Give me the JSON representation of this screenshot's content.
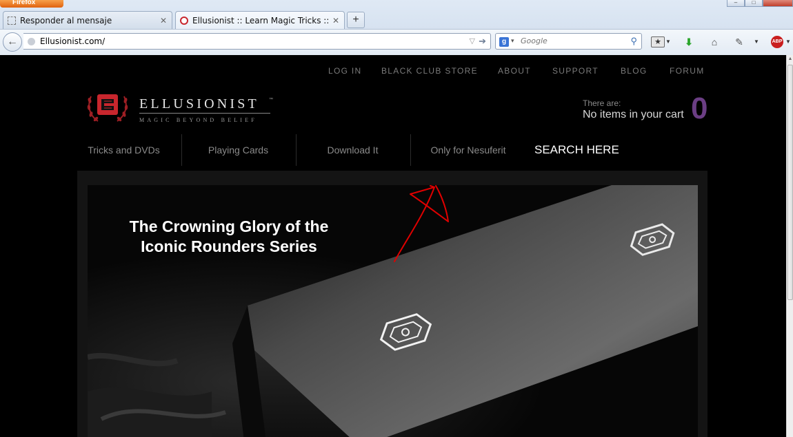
{
  "browser": {
    "app_button": "Firefox",
    "tabs": [
      {
        "label": "Responder al mensaje",
        "active": false
      },
      {
        "label": "Ellusionist :: Learn Magic Tricks :: Onli...",
        "active": true
      }
    ],
    "new_tab": "+",
    "url": "Ellusionist.com/",
    "search_engine": "Google",
    "search_placeholder": "Google"
  },
  "site": {
    "top_links": [
      "LOG IN",
      "BLACK CLUB STORE",
      "ABOUT",
      "SUPPORT",
      "BLOG",
      "FORUM"
    ],
    "logo": {
      "name": "ELLUSIONIST",
      "tm": "™",
      "tagline": "MAGIC BEYOND BELIEF"
    },
    "cart": {
      "prefix": "There are:",
      "status": "No items in your cart",
      "count": "0"
    },
    "main_nav": [
      "Tricks and DVDs",
      "Playing Cards",
      "Download It",
      "Only for Nesuferit",
      "SEARCH HERE"
    ],
    "hero": {
      "title_line1": "The Crowning Glory of the",
      "title_line2": "Iconic Rounders Series"
    }
  },
  "colors": {
    "accent_purple": "#6b3e84",
    "logo_red": "#c8262d",
    "annotation_red": "#e00000"
  }
}
